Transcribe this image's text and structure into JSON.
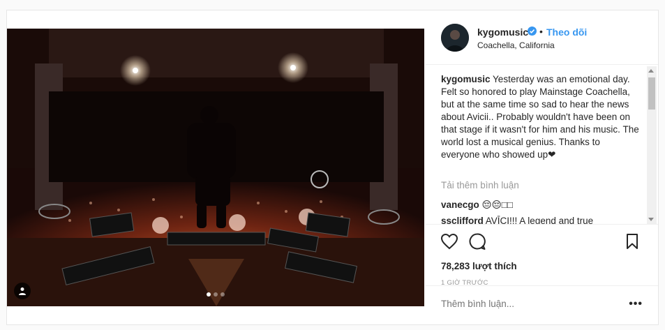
{
  "post": {
    "media": {
      "carousel_total": 3,
      "carousel_active": 0,
      "user_tag_icon": "user-tag-icon"
    },
    "header": {
      "username": "kygomusic",
      "separator": "•",
      "follow_label": "Theo dõi",
      "location": "Coachella, California",
      "verified_icon": "verified-badge-icon"
    },
    "caption": {
      "username": "kygomusic",
      "text": "Yesterday was an emotional day. Felt so honored to play Mainstage Coachella, but at the same time so sad to hear the news about Avicii.. Probably wouldn't have been on that stage if it wasn't for him and his music. The world lost a musical genius. Thanks to everyone who showed up❤"
    },
    "load_more": "Tải thêm bình luận",
    "comments": [
      {
        "username": "vanecgo",
        "text": "😔😔□□"
      },
      {
        "username": "ssclifford",
        "text": "AVĪCI!!! A legend and true"
      }
    ],
    "actions": {
      "like_icon": "heart-icon",
      "comment_icon": "comment-icon",
      "save_icon": "bookmark-icon"
    },
    "likes": "78,283 lượt thích",
    "time": "1 GIỜ TRƯỚC",
    "add_comment_placeholder": "Thêm bình luận...",
    "options_label": "•••",
    "colors": {
      "accent": "#3897f0",
      "text": "#262626",
      "muted": "#999999"
    }
  }
}
